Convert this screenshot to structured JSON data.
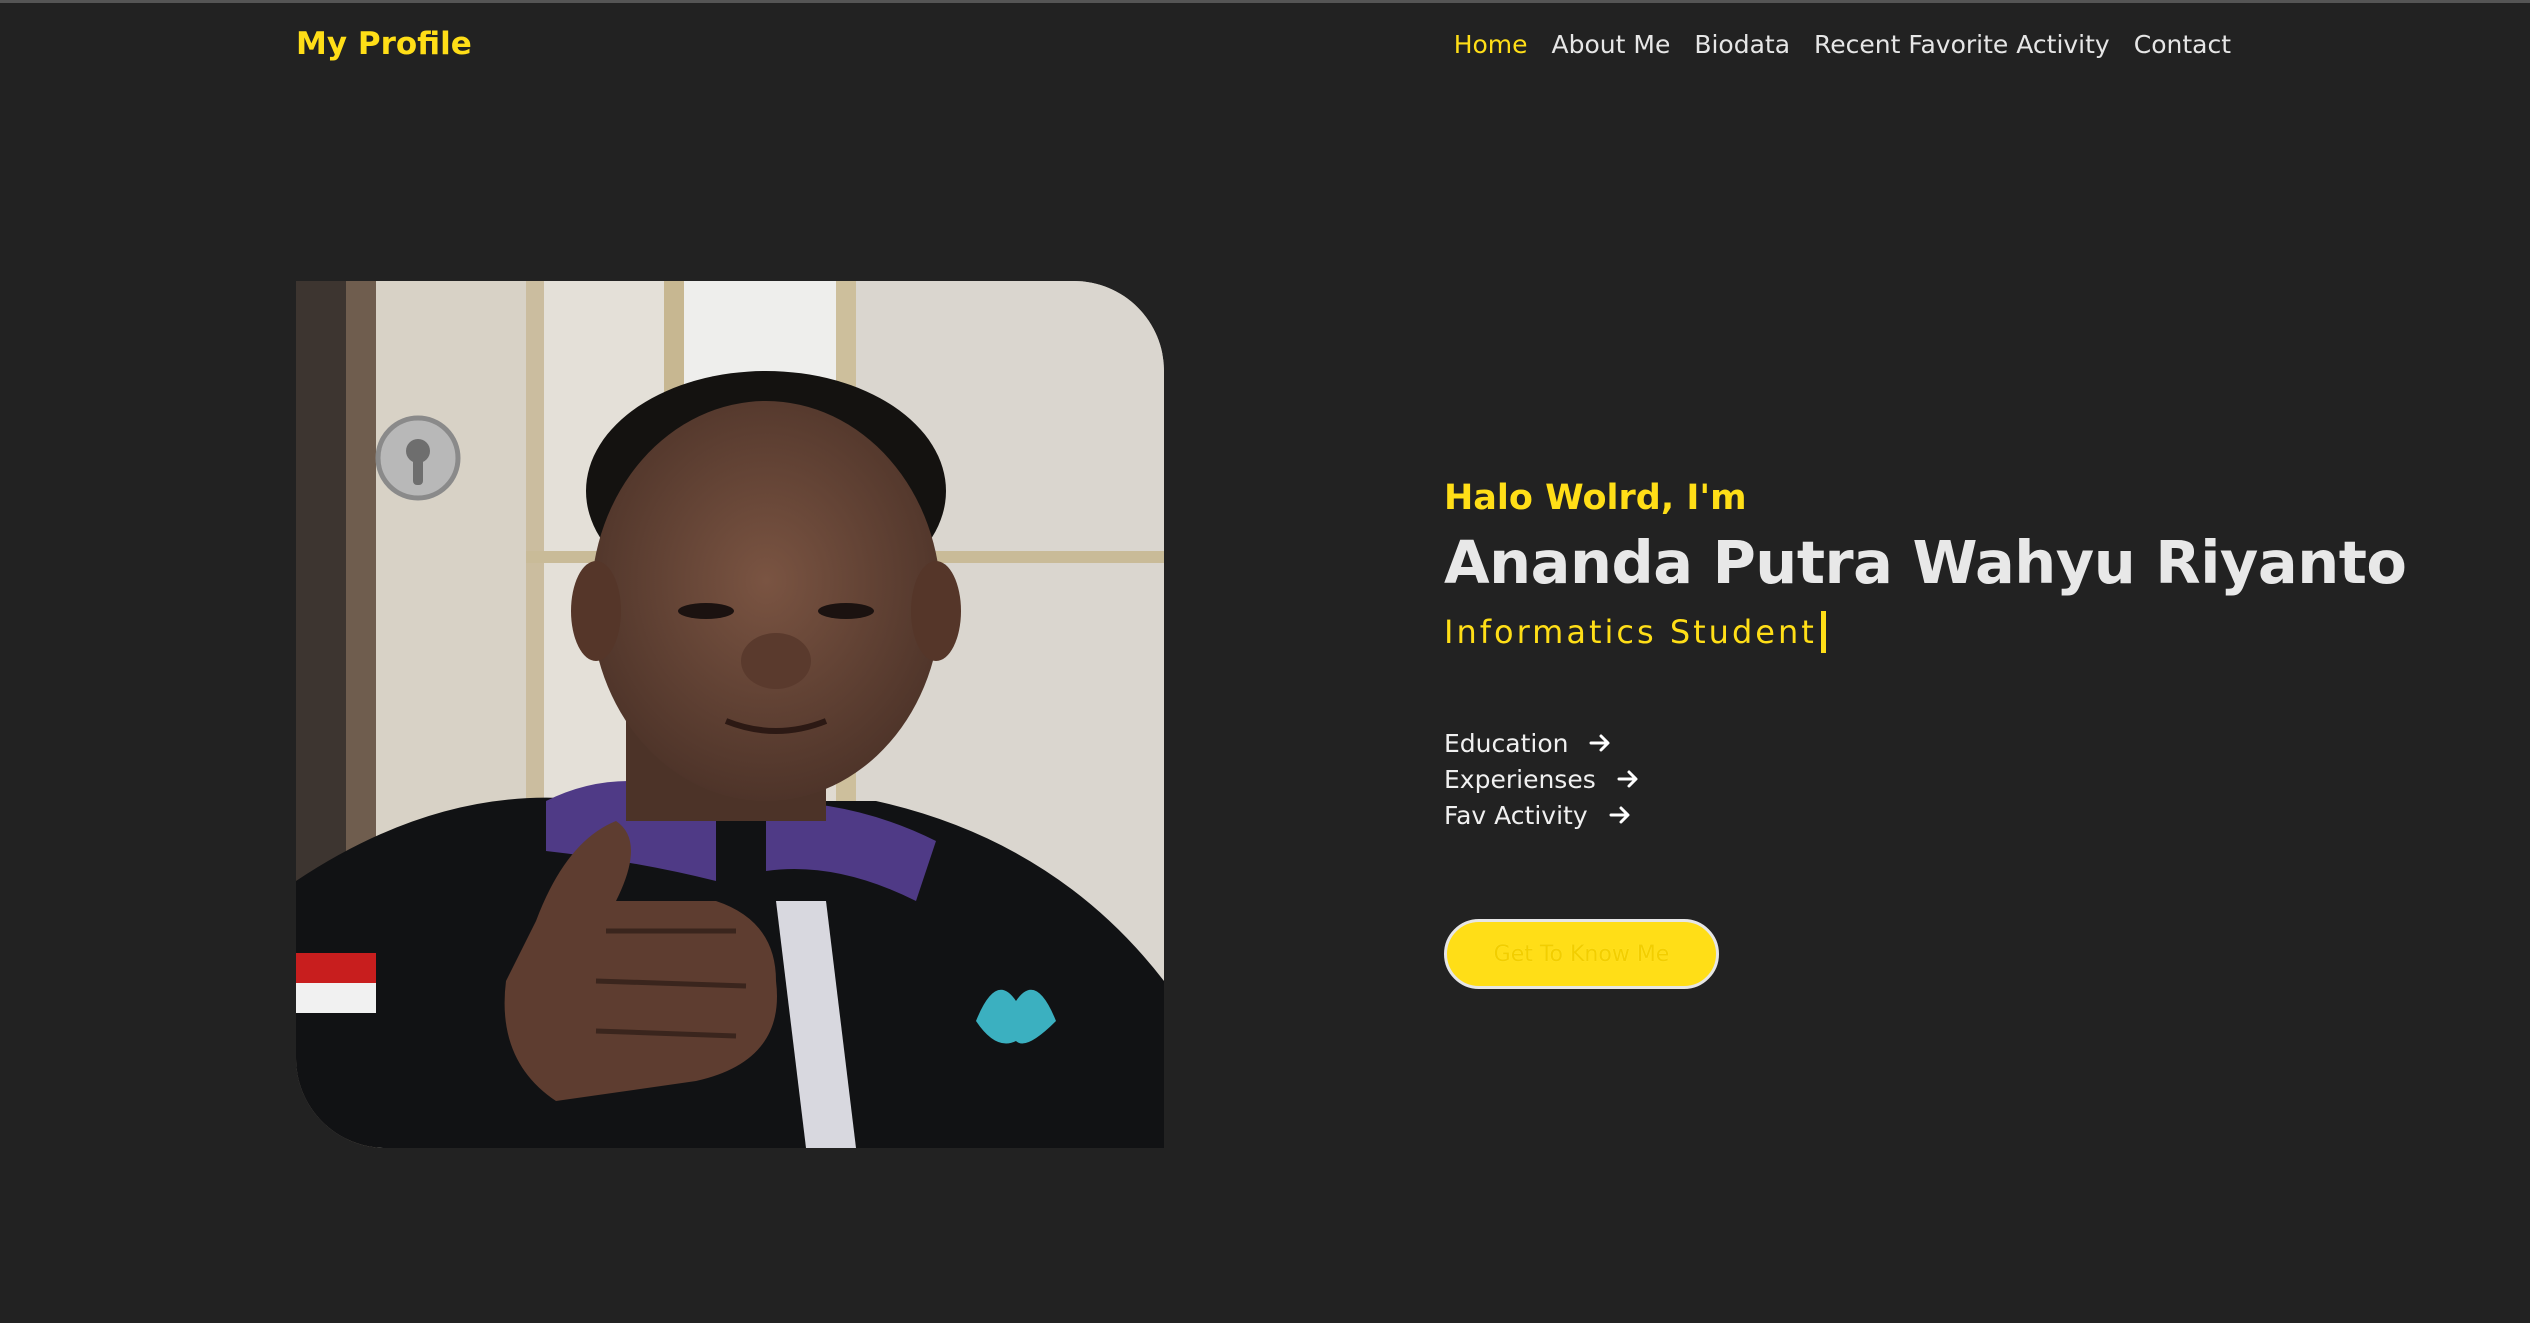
{
  "navbar": {
    "brand": "My Profile",
    "links": [
      {
        "label": "Home",
        "active": true
      },
      {
        "label": "About Me",
        "active": false
      },
      {
        "label": "Biodata",
        "active": false
      },
      {
        "label": "Recent Favorite Activity",
        "active": false
      },
      {
        "label": "Contact",
        "active": false
      }
    ]
  },
  "hero": {
    "greeting": "Halo Wolrd, I'm",
    "name": "Ananda Putra Wahyu Riyanto",
    "role": "Informatics Student",
    "links": [
      {
        "label": "Education",
        "icon": "arrow-right-icon"
      },
      {
        "label": "Experienses",
        "icon": "arrow-right-icon"
      },
      {
        "label": "Fav Activity",
        "icon": "arrow-right-icon"
      }
    ],
    "cta_label": "Get To Know Me"
  },
  "photo": {
    "subject": "profile-photo"
  },
  "colors": {
    "background": "#222222",
    "accent": "#ffde17",
    "text": "#e8e8e8"
  }
}
